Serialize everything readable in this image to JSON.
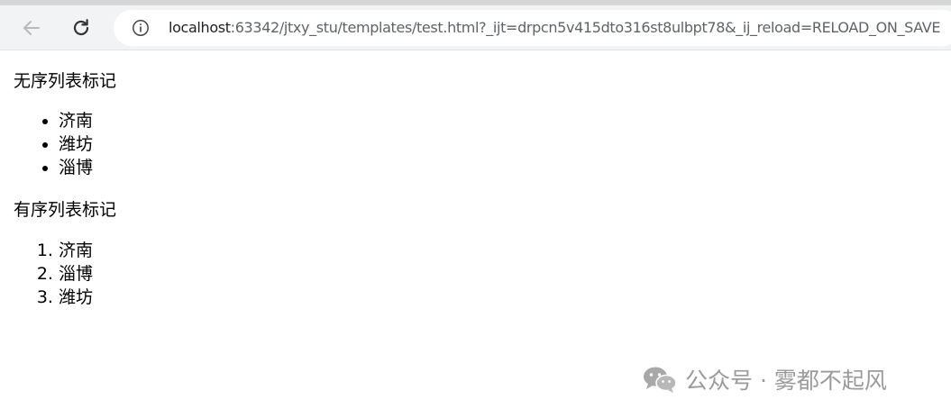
{
  "browser": {
    "url_host": "localhost",
    "url_rest": ":63342/jtxy_stu/templates/test.html?_ijt=drpcn5v415dto316st8ulbpt78&_ij_reload=RELOAD_ON_SAVE",
    "icons": {
      "back": "back-arrow-icon",
      "reload": "reload-icon",
      "info": "info-icon"
    }
  },
  "page": {
    "unordered_title": "无序列表标记",
    "unordered_items": [
      "济南",
      "潍坊",
      "淄博"
    ],
    "ordered_title": "有序列表标记",
    "ordered_items": [
      "济南",
      "淄博",
      "潍坊"
    ]
  },
  "watermark": {
    "text": "公众号 · 雾都不起风"
  }
}
